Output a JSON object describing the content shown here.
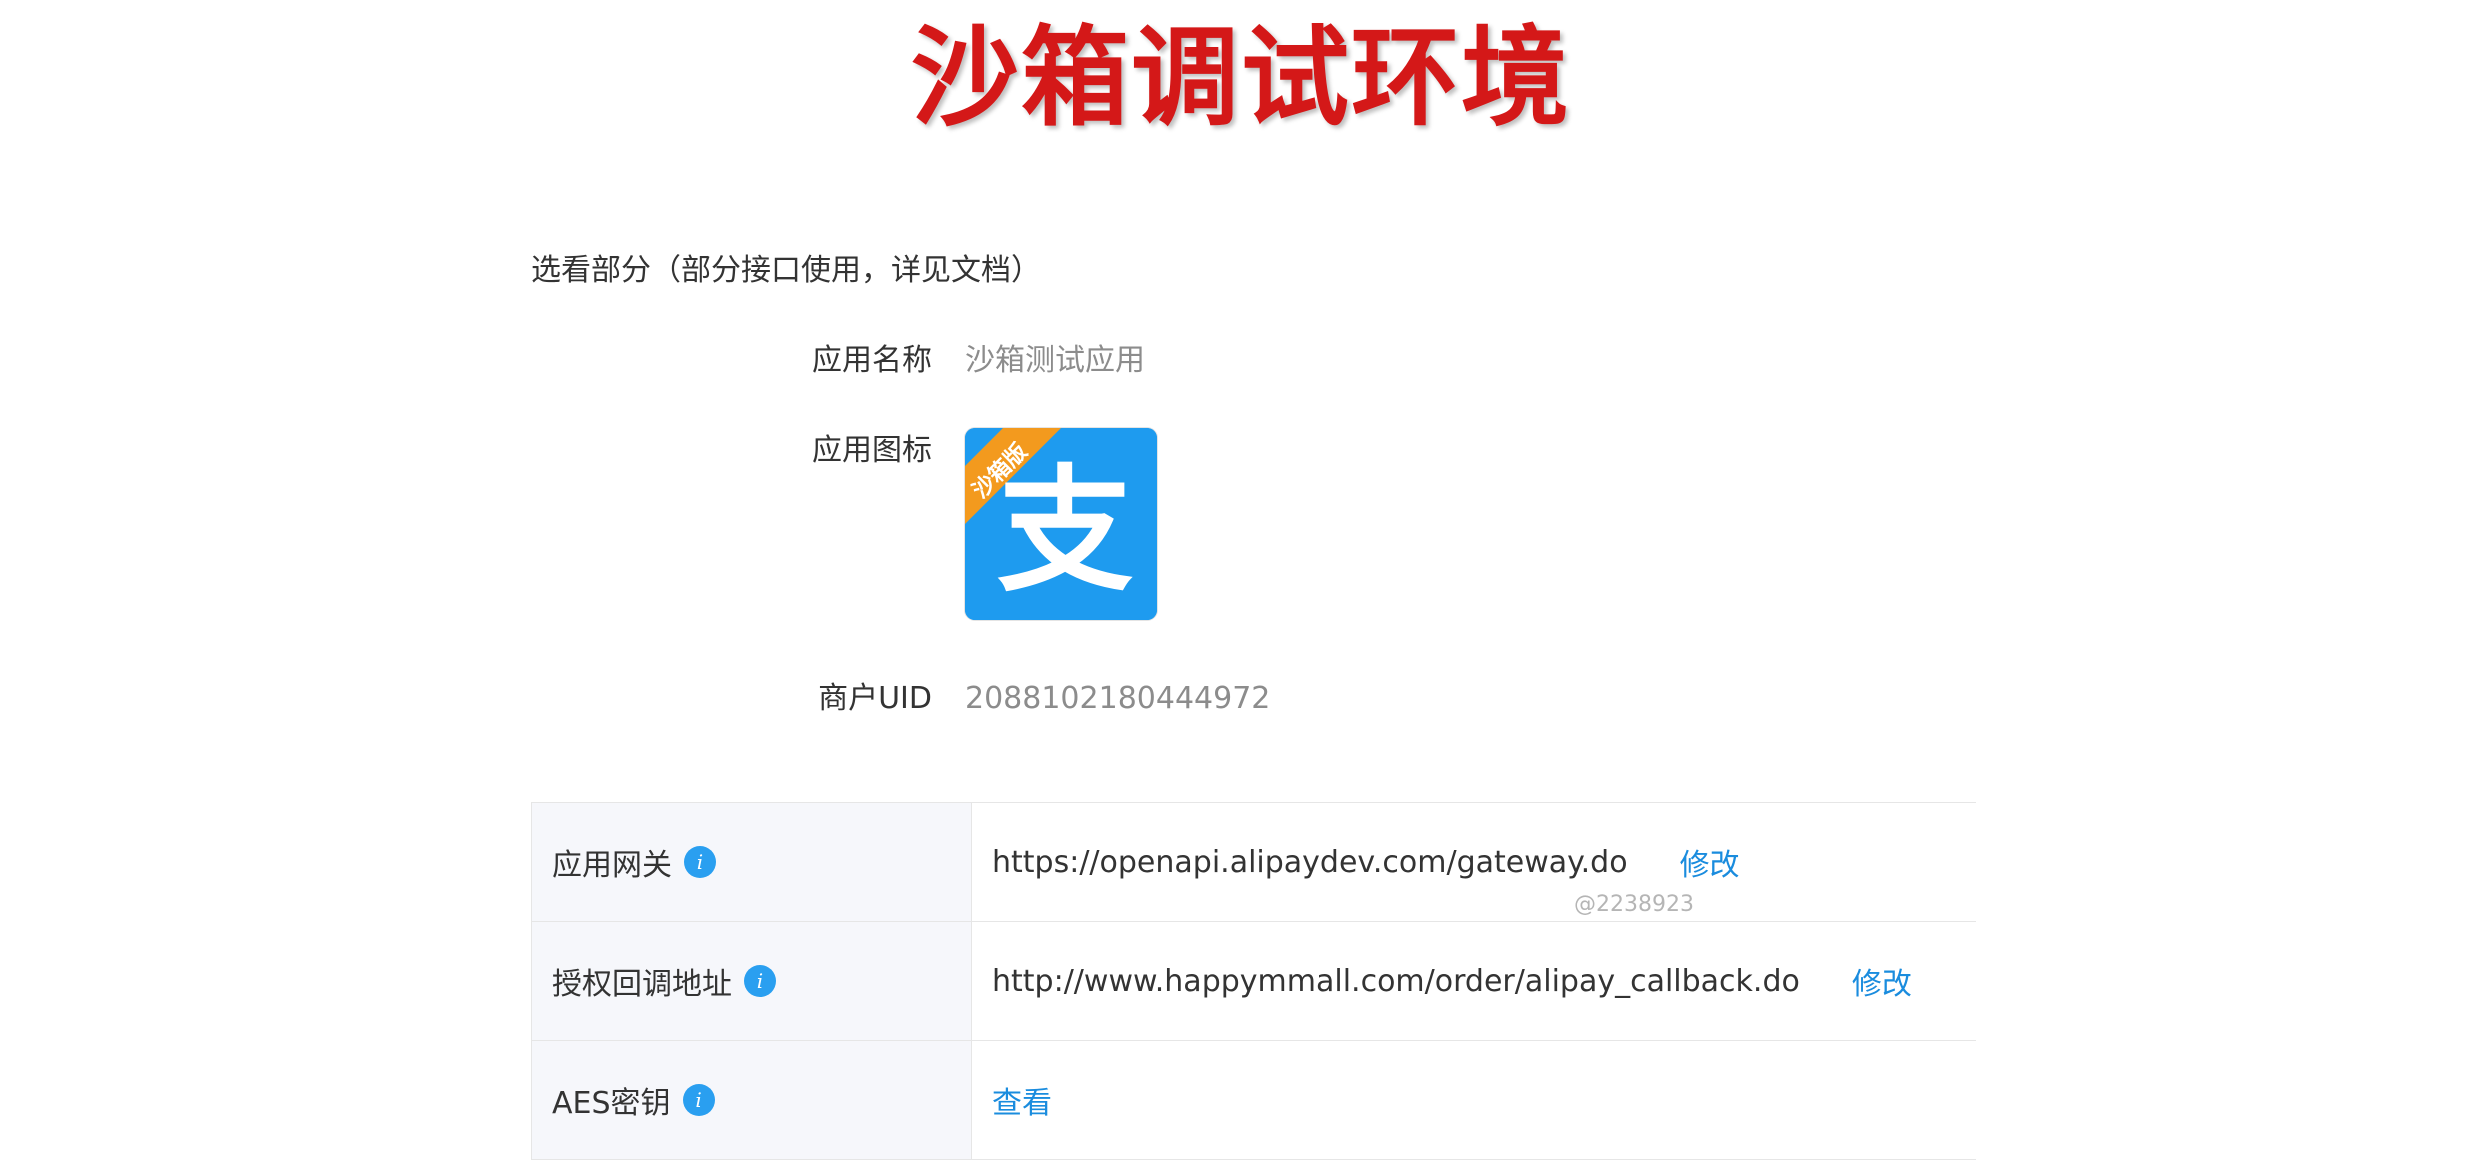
{
  "banner": {
    "title": "沙箱调试环境"
  },
  "section": {
    "heading": "选看部分（部分接口使用，详见文档）"
  },
  "app_info": {
    "name_label": "应用名称",
    "name_value": "沙箱测试应用",
    "icon_label": "应用图标",
    "icon_badge": "沙箱版",
    "icon_glyph": "支",
    "uid_label": "商户UID",
    "uid_value": "2088102180444972"
  },
  "table": {
    "rows": [
      {
        "label": "应用网关",
        "value": "https://openapi.alipaydev.com/gateway.do",
        "action": "修改"
      },
      {
        "label": "授权回调地址",
        "value": "http://www.happymmall.com/order/alipay_callback.do",
        "action": "修改"
      },
      {
        "label": "AES密钥",
        "value": "",
        "action": "查看"
      }
    ]
  },
  "watermark": {
    "text": "@2238923"
  },
  "colors": {
    "banner_red": "#d41818",
    "link_blue": "#1a8cde",
    "alipay_blue": "#1e9bef",
    "badge_orange": "#f39a1e",
    "info_blue": "#2a9ff0"
  },
  "icons": {
    "info": "info-icon",
    "app": "alipay-sandbox-icon"
  }
}
